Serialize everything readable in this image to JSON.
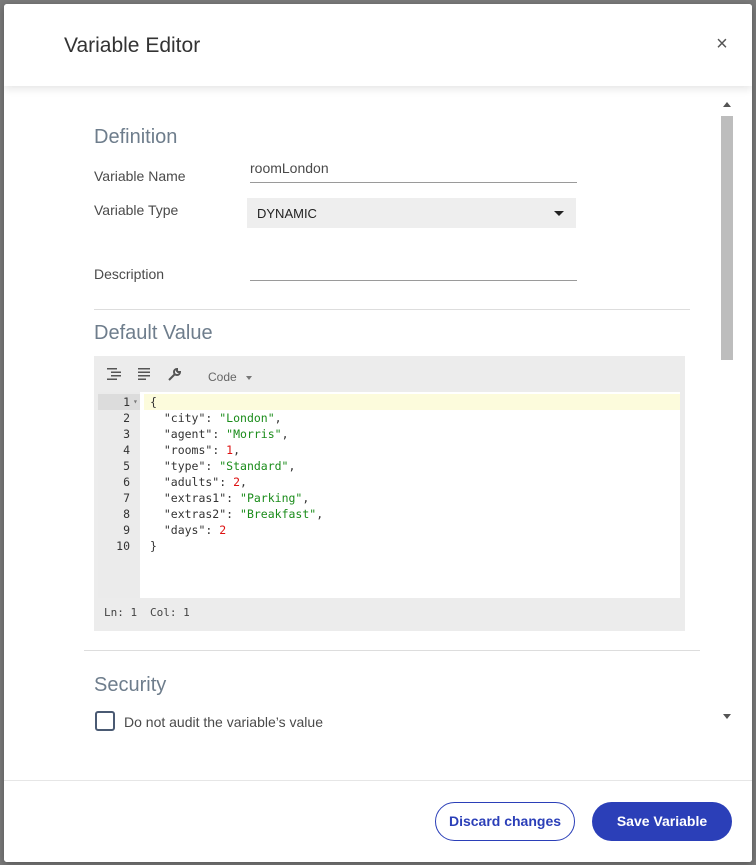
{
  "dialog": {
    "title": "Variable Editor",
    "close_label": "×"
  },
  "definition": {
    "heading": "Definition",
    "name_label": "Variable Name",
    "name_value": "roomLondon",
    "type_label": "Variable Type",
    "type_value": "DYNAMIC",
    "description_label": "Description",
    "description_value": ""
  },
  "default_value": {
    "heading": "Default Value",
    "mode_label": "Code",
    "status_ln": "Ln: 1",
    "status_col": "Col: 1",
    "line_numbers": [
      "1",
      "2",
      "3",
      "4",
      "5",
      "6",
      "7",
      "8",
      "9",
      "10"
    ],
    "lines": [
      [
        [
          "p",
          "{"
        ]
      ],
      [
        [
          "k",
          "  \"city\""
        ],
        [
          "p",
          ": "
        ],
        [
          "s",
          "\"London\""
        ],
        [
          "p",
          ","
        ]
      ],
      [
        [
          "k",
          "  \"agent\""
        ],
        [
          "p",
          ": "
        ],
        [
          "s",
          "\"Morris\""
        ],
        [
          "p",
          ","
        ]
      ],
      [
        [
          "k",
          "  \"rooms\""
        ],
        [
          "p",
          ": "
        ],
        [
          "n",
          "1"
        ],
        [
          "p",
          ","
        ]
      ],
      [
        [
          "k",
          "  \"type\""
        ],
        [
          "p",
          ": "
        ],
        [
          "s",
          "\"Standard\""
        ],
        [
          "p",
          ","
        ]
      ],
      [
        [
          "k",
          "  \"adults\""
        ],
        [
          "p",
          ": "
        ],
        [
          "n",
          "2"
        ],
        [
          "p",
          ","
        ]
      ],
      [
        [
          "k",
          "  \"extras1\""
        ],
        [
          "p",
          ": "
        ],
        [
          "s",
          "\"Parking\""
        ],
        [
          "p",
          ","
        ]
      ],
      [
        [
          "k",
          "  \"extras2\""
        ],
        [
          "p",
          ": "
        ],
        [
          "s",
          "\"Breakfast\""
        ],
        [
          "p",
          ","
        ]
      ],
      [
        [
          "k",
          "  \"days\""
        ],
        [
          "p",
          ": "
        ],
        [
          "n",
          "2"
        ]
      ],
      [
        [
          "p",
          "}"
        ]
      ]
    ]
  },
  "security": {
    "heading": "Security",
    "audit_label": "Do not audit the variable’s value",
    "audit_checked": false
  },
  "footer": {
    "discard_label": "Discard changes",
    "save_label": "Save Variable"
  },
  "colors": {
    "primary": "#2b3fb8",
    "section_heading": "#6e7d8c",
    "string": "#1a8c1a",
    "number": "#dd1111"
  }
}
